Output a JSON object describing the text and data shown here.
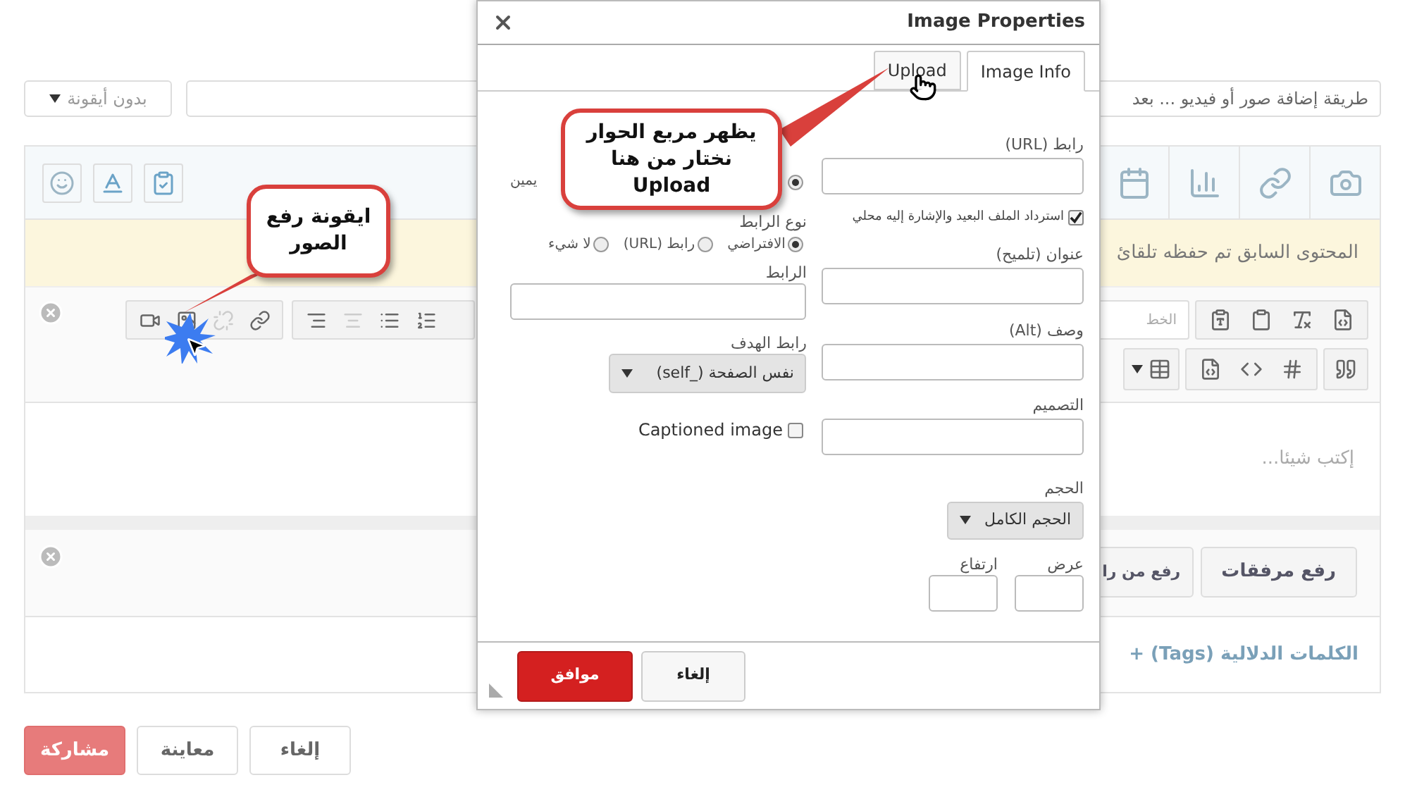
{
  "page": {
    "icon_select": "بدون أيقونة",
    "title_field": "طريقة إضافة صور أو فيديو ... بعد",
    "notice": "المحتوى السابق تم حفظه تلقائ",
    "font_field_placeholder": "الخط",
    "editor_placeholder": "إكتب شيئا...",
    "upload_buttons": [
      "رفع مرفقات",
      "رفع من را"
    ],
    "tags_link": "الكلمات الدلالية (Tags) +",
    "actions": [
      {
        "label": "إلغاء",
        "kind": "default"
      },
      {
        "label": "معاينة",
        "kind": "default"
      },
      {
        "label": "مشاركة",
        "kind": "primary"
      }
    ]
  },
  "dialog": {
    "title": "Image Properties",
    "tabs": [
      {
        "label": "Image Info",
        "selected": true
      },
      {
        "label": "Upload",
        "selected": false
      }
    ],
    "url_label": "رابط (URL)",
    "fetch_checkbox": {
      "label": "استرداد الملف البعيد والإشارة إليه محلي",
      "checked": true
    },
    "title_label": "عنوان (تلميح)",
    "alt_label": "وصف (Alt)",
    "style_label": "التصميم",
    "size_label": "الحجم",
    "size_select": "الحجم الكامل",
    "width_label": "عرض",
    "height_label": "ارتفاع",
    "align": {
      "selected": true,
      "label": "يمين"
    },
    "link_type": {
      "label": "نوع الرابط",
      "options": [
        {
          "label": "الافتراضي",
          "selected": true
        },
        {
          "label": "رابط (URL)",
          "selected": false
        },
        {
          "label": "لا شيء",
          "selected": false
        }
      ]
    },
    "link_label": "الرابط",
    "target_label": "رابط الهدف",
    "target_select": "نفس الصفحة (_self)",
    "captioned": {
      "label": "Captioned image",
      "checked": false
    },
    "buttons": [
      {
        "label": "إلغاء",
        "kind": "default"
      },
      {
        "label": "موافق",
        "kind": "primary"
      }
    ]
  },
  "callouts": [
    {
      "text": "ايقونة رفع\nالصور"
    },
    {
      "text": "يظهر مربع الحوار\nنختار من هنا\nUpload"
    }
  ]
}
